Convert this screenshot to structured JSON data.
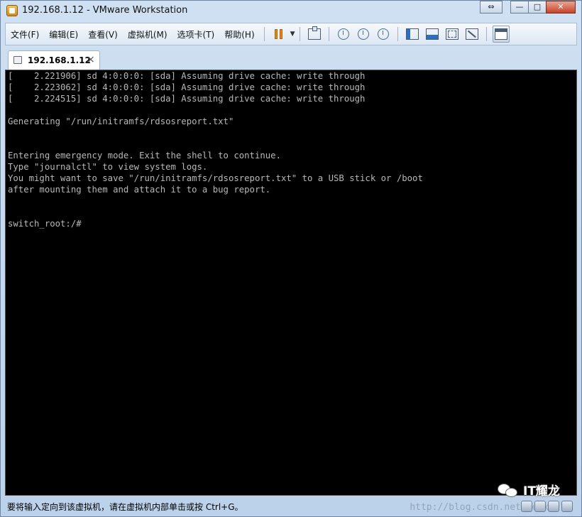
{
  "window": {
    "title": "192.168.1.12 - VMware Workstation",
    "controls": {
      "restore_pane": "⇔",
      "minimize": "—",
      "maximize": "□",
      "close": "✕"
    }
  },
  "menubar": {
    "items": [
      "文件(F)",
      "编辑(E)",
      "查看(V)",
      "虚拟机(M)",
      "选项卡(T)",
      "帮助(H)"
    ],
    "dropdown_arrow": "▼"
  },
  "toolbar": {
    "icons": [
      "pause-icon",
      "send-ctrl-alt-del-icon",
      "snapshot-take-icon",
      "snapshot-revert-icon",
      "snapshot-manager-icon",
      "sidebar-icon",
      "console-view-icon",
      "fullscreen-icon",
      "unity-icon",
      "view-options-icon"
    ],
    "colors": {
      "pause": "#e38a12",
      "accent": "#2b6fbd"
    }
  },
  "tabs": [
    {
      "label": "192.168.1.12",
      "close": "×",
      "active": true
    }
  ],
  "terminal": {
    "lines": [
      "[    2.221906] sd 4:0:0:0: [sda] Assuming drive cache: write through",
      "[    2.223062] sd 4:0:0:0: [sda] Assuming drive cache: write through",
      "[    2.224515] sd 4:0:0:0: [sda] Assuming drive cache: write through",
      "",
      "Generating \"/run/initramfs/rdsosreport.txt\"",
      "",
      "",
      "Entering emergency mode. Exit the shell to continue.",
      "Type \"journalctl\" to view system logs.",
      "You might want to save \"/run/initramfs/rdsosreport.txt\" to a USB stick or /boot",
      "after mounting them and attach it to a bug report.",
      "",
      "",
      "switch_root:/#"
    ],
    "background": "#000000",
    "foreground": "#b7b7b7"
  },
  "statusbar": {
    "text": "要将输入定向到该虚拟机，请在虚拟机内部单击或按 Ctrl+G。",
    "watermark": "http://blog.csdn.net/weix"
  },
  "branding": {
    "text": "IT耀龙",
    "icon": "wechat-icon"
  }
}
